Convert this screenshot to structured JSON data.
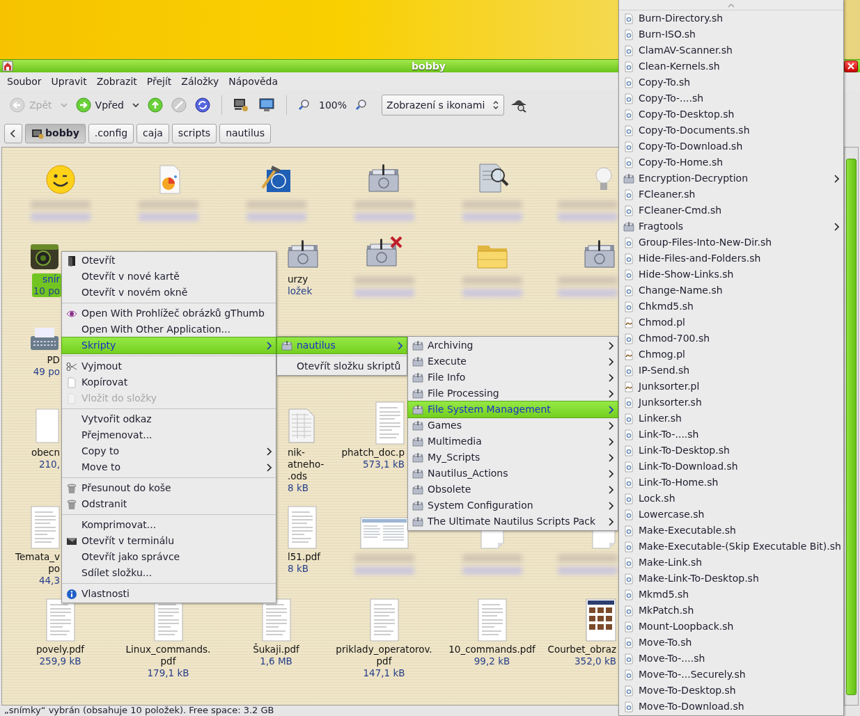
{
  "window": {
    "title": "bobby"
  },
  "menubar": [
    "Soubor",
    "Upravit",
    "Zobrazit",
    "Přejít",
    "Záložky",
    "Nápověda"
  ],
  "toolbar": [
    {
      "kind": "back",
      "label": "Zpět",
      "disabled": true
    },
    {
      "kind": "forward",
      "label": "Vpřed",
      "disabled": false
    },
    {
      "kind": "up",
      "disabled": false
    },
    {
      "kind": "stop",
      "disabled": true
    },
    {
      "kind": "reload",
      "disabled": false
    },
    {
      "kind": "separator"
    },
    {
      "kind": "network"
    },
    {
      "kind": "computer"
    },
    {
      "kind": "separator"
    },
    {
      "kind": "zoom-out"
    },
    {
      "kind": "zoom-level",
      "label": "100%"
    },
    {
      "kind": "zoom-in"
    },
    {
      "kind": "view-select",
      "value": "Zobrazení s ikonami"
    },
    {
      "kind": "spy"
    }
  ],
  "pathbar": [
    {
      "label": "bobby",
      "selected": true
    },
    {
      "label": ".config",
      "selected": false
    },
    {
      "label": "caja",
      "selected": false
    },
    {
      "label": "scripts",
      "selected": false
    },
    {
      "label": "nautilus",
      "selected": false
    }
  ],
  "file_rows": [
    [
      {
        "kind": "smiley",
        "blurred": true,
        "selected": false,
        "clipped_left": false,
        "clipped_right": false
      },
      {
        "kind": "chart-doc",
        "blurred": true,
        "selected": false,
        "clipped_left": false,
        "clipped_right": false
      },
      {
        "kind": "hammer",
        "blurred": true,
        "selected": false,
        "clipped_left": false,
        "clipped_right": false
      },
      {
        "kind": "folder",
        "blurred": true,
        "selected": false,
        "clipped_left": false,
        "clipped_right": false
      },
      {
        "kind": "magnifier-doc",
        "blurred": true,
        "selected": false,
        "clipped_left": false,
        "clipped_right": false
      },
      {
        "kind": "bulb",
        "blurred": true,
        "selected": false,
        "clipped_left": false,
        "clipped_right": true
      }
    ],
    [
      {
        "kind": "camera",
        "name_lines": [
          "snír"
        ],
        "size_lines": [
          "10 po"
        ],
        "blurred": false,
        "selected": true,
        "clipped_left": false,
        "clipped_right": true
      },
      null,
      {
        "kind": "folder",
        "name_lines": [
          "urzy"
        ],
        "size_lines": [
          "ložek"
        ],
        "blurred": false,
        "selected": false,
        "clipped_left": true,
        "clipped_right": false
      },
      {
        "kind": "folder-x",
        "blurred": true,
        "selected": false,
        "clipped_left": false,
        "clipped_right": false
      },
      {
        "kind": "folder-yellow",
        "blurred": true,
        "selected": false,
        "clipped_left": false,
        "clipped_right": false
      },
      {
        "kind": "folder",
        "blurred": true,
        "selected": false,
        "clipped_left": false,
        "clipped_right": true
      }
    ],
    [
      {
        "kind": "typewriter",
        "name_lines": [
          "PD"
        ],
        "size_lines": [
          "49 po"
        ],
        "blurred": false,
        "selected": false,
        "clipped_left": false,
        "clipped_right": true
      },
      null,
      null,
      null,
      null,
      null
    ],
    [
      {
        "kind": "doc",
        "name_lines": [
          "obecn"
        ],
        "size_lines": [
          "210,"
        ],
        "blurred": false,
        "selected": false,
        "clipped_left": false,
        "clipped_right": true
      },
      null,
      {
        "kind": "sheet",
        "name_lines": [
          "nik-",
          "atneho-",
          ".ods"
        ],
        "size_lines": [
          "8 kB"
        ],
        "blurred": false,
        "selected": false,
        "clipped_left": true,
        "clipped_right": false
      },
      {
        "kind": "pdf",
        "name_lines": [
          "phatch_doc.p"
        ],
        "size_lines": [
          "573,1 kB"
        ],
        "blurred": false,
        "selected": false,
        "clipped_left": false,
        "clipped_right": true
      },
      null,
      null
    ],
    [
      {
        "kind": "pdf",
        "name_lines": [
          "Temata_v",
          "po"
        ],
        "size_lines": [
          "44,3"
        ],
        "blurred": false,
        "selected": false,
        "clipped_left": false,
        "clipped_right": true
      },
      null,
      {
        "kind": "pdf",
        "name_lines": [
          "l51.pdf"
        ],
        "size_lines": [
          "8 kB"
        ],
        "blurred": false,
        "selected": false,
        "clipped_left": true,
        "clipped_right": false
      },
      {
        "kind": "screenshot",
        "blurred": true,
        "selected": false,
        "clipped_left": false,
        "clipped_right": false
      },
      {
        "kind": "paper",
        "blurred": true,
        "selected": false,
        "clipped_left": false,
        "clipped_right": false
      },
      {
        "kind": "paper",
        "blurred": true,
        "selected": false,
        "clipped_left": false,
        "clipped_right": true
      }
    ],
    [
      {
        "kind": "pdf",
        "name_lines": [
          "povely.pdf"
        ],
        "size_lines": [
          "259,9 kB"
        ],
        "blurred": false,
        "selected": false,
        "clipped_left": false,
        "clipped_right": false
      },
      {
        "kind": "pdf",
        "name_lines": [
          "Linux_commands.",
          "pdf"
        ],
        "size_lines": [
          "179,1 kB"
        ],
        "blurred": false,
        "selected": false,
        "clipped_left": false,
        "clipped_right": false
      },
      {
        "kind": "pdf",
        "name_lines": [
          "Šukaji.pdf"
        ],
        "size_lines": [
          "1,6 MB"
        ],
        "blurred": false,
        "selected": false,
        "clipped_left": false,
        "clipped_right": false
      },
      {
        "kind": "pdf",
        "name_lines": [
          "priklady_operatorov.",
          "pdf"
        ],
        "size_lines": [
          "147,1 kB"
        ],
        "blurred": false,
        "selected": false,
        "clipped_left": false,
        "clipped_right": false
      },
      {
        "kind": "pdf",
        "name_lines": [
          "10_commands.pdf"
        ],
        "size_lines": [
          "99,2 kB"
        ],
        "blurred": false,
        "selected": false,
        "clipped_left": false,
        "clipped_right": false
      },
      {
        "kind": "photos",
        "name_lines": [
          "Courbet_obraz"
        ],
        "size_lines": [
          "352,0 kB"
        ],
        "blurred": false,
        "selected": false,
        "clipped_left": false,
        "clipped_right": true
      }
    ]
  ],
  "status_bar": "„snímky“ vybrán (obsahuje 10 položek). Free space: 3.2 GB",
  "context_menu": [
    [
      {
        "label": "Otevřít",
        "kind": "open",
        "disabled": false,
        "submenu": false,
        "selected": false
      },
      {
        "label": "Otevřít v nové kartě",
        "kind": "none",
        "disabled": false,
        "submenu": false,
        "selected": false
      },
      {
        "label": "Otevřít v novém okně",
        "kind": "none",
        "disabled": false,
        "submenu": false,
        "selected": false
      }
    ],
    [
      {
        "label": "Open With Prohlížeč obrázků gThumb",
        "kind": "eye",
        "disabled": false,
        "submenu": false,
        "selected": false
      },
      {
        "label": "Open With Other Application...",
        "kind": "none",
        "disabled": false,
        "submenu": false,
        "selected": false
      },
      {
        "label": "Skripty",
        "kind": "none",
        "disabled": false,
        "submenu": true,
        "selected": true
      }
    ],
    [
      {
        "label": "Vyjmout",
        "kind": "scissors",
        "disabled": false,
        "submenu": false,
        "selected": false
      },
      {
        "label": "Kopírovat",
        "kind": "page",
        "disabled": false,
        "submenu": false,
        "selected": false
      },
      {
        "label": "Vložit do složky",
        "kind": "page",
        "disabled": true,
        "submenu": false,
        "selected": false
      }
    ],
    [
      {
        "label": "Vytvořit odkaz",
        "kind": "none",
        "disabled": false,
        "submenu": false,
        "selected": false
      },
      {
        "label": "Přejmenovat...",
        "kind": "none",
        "disabled": false,
        "submenu": false,
        "selected": false
      },
      {
        "label": "Copy to",
        "kind": "none",
        "disabled": false,
        "submenu": true,
        "selected": false
      },
      {
        "label": "Move to",
        "kind": "none",
        "disabled": false,
        "submenu": true,
        "selected": false
      }
    ],
    [
      {
        "label": "Přesunout do koše",
        "kind": "trash",
        "disabled": false,
        "submenu": false,
        "selected": false
      },
      {
        "label": "Odstranit",
        "kind": "trash",
        "disabled": false,
        "submenu": false,
        "selected": false
      }
    ],
    [
      {
        "label": "Komprimovat...",
        "kind": "none",
        "disabled": false,
        "submenu": false,
        "selected": false
      },
      {
        "label": "Otevřít v terminálu",
        "kind": "terminal",
        "disabled": false,
        "submenu": false,
        "selected": false
      },
      {
        "label": "Otevřít jako správce",
        "kind": "none",
        "disabled": false,
        "submenu": false,
        "selected": false
      },
      {
        "label": "Sdílet složku...",
        "kind": "none",
        "disabled": false,
        "submenu": false,
        "selected": false
      }
    ],
    [
      {
        "label": "Vlastnosti",
        "kind": "info",
        "disabled": false,
        "submenu": false,
        "selected": false
      }
    ]
  ],
  "scripts_menu": [
    [
      {
        "label": "nautilus",
        "kind": "folder",
        "disabled": false,
        "submenu": true,
        "selected": true
      }
    ],
    [
      {
        "label": "Otevřít složku skriptů",
        "kind": "none",
        "disabled": false,
        "submenu": false,
        "selected": false
      }
    ]
  ],
  "nautilus_menu": [
    [
      {
        "label": "Archiving",
        "kind": "folder",
        "disabled": false,
        "submenu": true,
        "selected": false
      },
      {
        "label": "Execute",
        "kind": "folder",
        "disabled": false,
        "submenu": true,
        "selected": false
      },
      {
        "label": "File Info",
        "kind": "folder",
        "disabled": false,
        "submenu": true,
        "selected": false
      },
      {
        "label": "File Processing",
        "kind": "folder",
        "disabled": false,
        "submenu": true,
        "selected": false
      },
      {
        "label": "File System Management",
        "kind": "folder",
        "disabled": false,
        "submenu": true,
        "selected": true
      },
      {
        "label": "Games",
        "kind": "folder",
        "disabled": false,
        "submenu": true,
        "selected": false
      },
      {
        "label": "Multimedia",
        "kind": "folder",
        "disabled": false,
        "submenu": true,
        "selected": false
      },
      {
        "label": "My_Scripts",
        "kind": "folder",
        "disabled": false,
        "submenu": true,
        "selected": false
      },
      {
        "label": "Nautilus_Actions",
        "kind": "folder",
        "disabled": false,
        "submenu": true,
        "selected": false
      },
      {
        "label": "Obsolete",
        "kind": "folder",
        "disabled": false,
        "submenu": true,
        "selected": false
      },
      {
        "label": "System Configuration",
        "kind": "folder",
        "disabled": false,
        "submenu": true,
        "selected": false
      },
      {
        "label": "The Ultimate Nautilus Scripts Pack",
        "kind": "folder",
        "disabled": false,
        "submenu": true,
        "selected": false
      }
    ]
  ],
  "file_system_menu": [
    [
      {
        "label": "Burn-Directory.sh",
        "kind": "script",
        "disabled": false,
        "submenu": false,
        "selected": false
      },
      {
        "label": "Burn-ISO.sh",
        "kind": "script",
        "disabled": false,
        "submenu": false,
        "selected": false
      },
      {
        "label": "ClamAV-Scanner.sh",
        "kind": "script",
        "disabled": false,
        "submenu": false,
        "selected": false
      },
      {
        "label": "Clean-Kernels.sh",
        "kind": "script",
        "disabled": false,
        "submenu": false,
        "selected": false
      },
      {
        "label": "Copy-To.sh",
        "kind": "script",
        "disabled": false,
        "submenu": false,
        "selected": false
      },
      {
        "label": "Copy-To-....sh",
        "kind": "script",
        "disabled": false,
        "submenu": false,
        "selected": false
      },
      {
        "label": "Copy-To-Desktop.sh",
        "kind": "script",
        "disabled": false,
        "submenu": false,
        "selected": false
      },
      {
        "label": "Copy-To-Documents.sh",
        "kind": "script",
        "disabled": false,
        "submenu": false,
        "selected": false
      },
      {
        "label": "Copy-To-Download.sh",
        "kind": "script",
        "disabled": false,
        "submenu": false,
        "selected": false
      },
      {
        "label": "Copy-To-Home.sh",
        "kind": "script",
        "disabled": false,
        "submenu": false,
        "selected": false
      },
      {
        "label": "Encryption-Decryption",
        "kind": "folder",
        "disabled": false,
        "submenu": true,
        "selected": false
      },
      {
        "label": "FCleaner.sh",
        "kind": "script",
        "disabled": false,
        "submenu": false,
        "selected": false
      },
      {
        "label": "FCleaner-Cmd.sh",
        "kind": "script",
        "disabled": false,
        "submenu": false,
        "selected": false
      },
      {
        "label": "Fragtools",
        "kind": "folder",
        "disabled": false,
        "submenu": true,
        "selected": false
      },
      {
        "label": "Group-Files-Into-New-Dir.sh",
        "kind": "script",
        "disabled": false,
        "submenu": false,
        "selected": false
      },
      {
        "label": "Hide-Files-and-Folders.sh",
        "kind": "script",
        "disabled": false,
        "submenu": false,
        "selected": false
      },
      {
        "label": "Hide-Show-Links.sh",
        "kind": "script",
        "disabled": false,
        "submenu": false,
        "selected": false
      },
      {
        "label": "Change-Name.sh",
        "kind": "script",
        "disabled": false,
        "submenu": false,
        "selected": false
      },
      {
        "label": "Chkmd5.sh",
        "kind": "script",
        "disabled": false,
        "submenu": false,
        "selected": false
      },
      {
        "label": "Chmod.pl",
        "kind": "perl",
        "disabled": false,
        "submenu": false,
        "selected": false
      },
      {
        "label": "Chmod-700.sh",
        "kind": "script",
        "disabled": false,
        "submenu": false,
        "selected": false
      },
      {
        "label": "Chmog.pl",
        "kind": "perl",
        "disabled": false,
        "submenu": false,
        "selected": false
      },
      {
        "label": "IP-Send.sh",
        "kind": "script",
        "disabled": false,
        "submenu": false,
        "selected": false
      },
      {
        "label": "Junksorter.pl",
        "kind": "perl",
        "disabled": false,
        "submenu": false,
        "selected": false
      },
      {
        "label": "Junksorter.sh",
        "kind": "script",
        "disabled": false,
        "submenu": false,
        "selected": false
      },
      {
        "label": "Linker.sh",
        "kind": "script",
        "disabled": false,
        "submenu": false,
        "selected": false
      },
      {
        "label": "Link-To-....sh",
        "kind": "script",
        "disabled": false,
        "submenu": false,
        "selected": false
      },
      {
        "label": "Link-To-Desktop.sh",
        "kind": "script",
        "disabled": false,
        "submenu": false,
        "selected": false
      },
      {
        "label": "Link-To-Download.sh",
        "kind": "script",
        "disabled": false,
        "submenu": false,
        "selected": false
      },
      {
        "label": "Link-To-Home.sh",
        "kind": "script",
        "disabled": false,
        "submenu": false,
        "selected": false
      },
      {
        "label": "Lock.sh",
        "kind": "script",
        "disabled": false,
        "submenu": false,
        "selected": false
      },
      {
        "label": "Lowercase.sh",
        "kind": "script",
        "disabled": false,
        "submenu": false,
        "selected": false
      },
      {
        "label": "Make-Executable.sh",
        "kind": "script",
        "disabled": false,
        "submenu": false,
        "selected": false
      },
      {
        "label": "Make-Executable-(Skip Executable Bit).sh",
        "kind": "script",
        "disabled": false,
        "submenu": false,
        "selected": false
      },
      {
        "label": "Make-Link.sh",
        "kind": "script",
        "disabled": false,
        "submenu": false,
        "selected": false
      },
      {
        "label": "Make-Link-To-Desktop.sh",
        "kind": "script",
        "disabled": false,
        "submenu": false,
        "selected": false
      },
      {
        "label": "Mkmd5.sh",
        "kind": "script",
        "disabled": false,
        "submenu": false,
        "selected": false
      },
      {
        "label": "MkPatch.sh",
        "kind": "script",
        "disabled": false,
        "submenu": false,
        "selected": false
      },
      {
        "label": "Mount-Loopback.sh",
        "kind": "script",
        "disabled": false,
        "submenu": false,
        "selected": false
      },
      {
        "label": "Move-To.sh",
        "kind": "script",
        "disabled": false,
        "submenu": false,
        "selected": false
      },
      {
        "label": "Move-To-....sh",
        "kind": "script",
        "disabled": false,
        "submenu": false,
        "selected": false
      },
      {
        "label": "Move-To-...Securely.sh",
        "kind": "script",
        "disabled": false,
        "submenu": false,
        "selected": false
      },
      {
        "label": "Move-To-Desktop.sh",
        "kind": "script",
        "disabled": false,
        "submenu": false,
        "selected": false
      },
      {
        "label": "Move-To-Download.sh",
        "kind": "script",
        "disabled": false,
        "submenu": false,
        "selected": false
      }
    ]
  ]
}
